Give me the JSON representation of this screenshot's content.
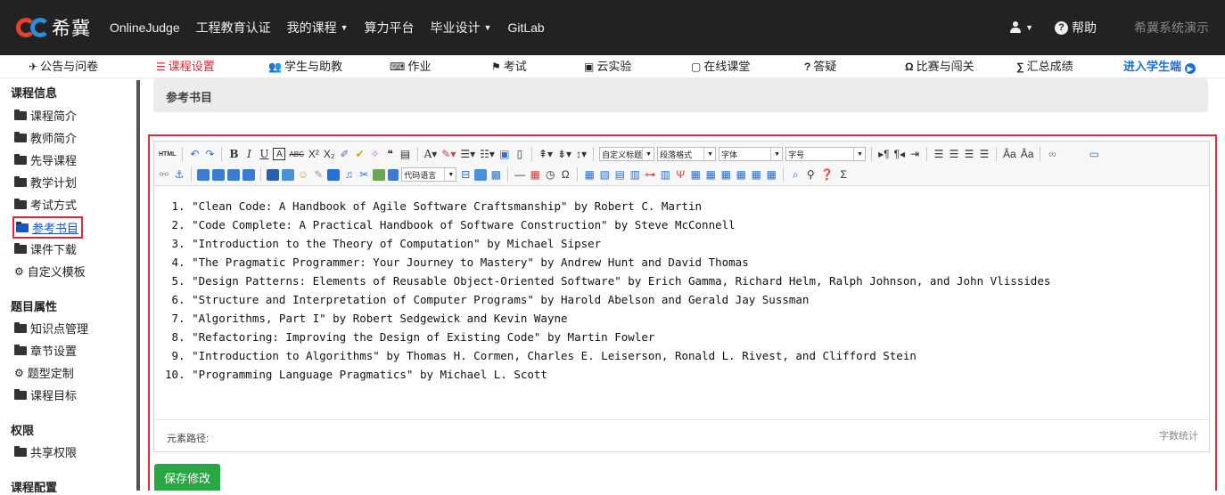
{
  "header": {
    "logo_text": "希冀",
    "nav": [
      {
        "label": "OnlineJudge",
        "dropdown": false
      },
      {
        "label": "工程教育认证",
        "dropdown": false
      },
      {
        "label": "我的课程",
        "dropdown": true
      },
      {
        "label": "算力平台",
        "dropdown": false
      },
      {
        "label": "毕业设计",
        "dropdown": true
      },
      {
        "label": "GitLab",
        "dropdown": false
      }
    ],
    "help_label": "帮助",
    "system_demo": "希冀系统演示"
  },
  "course_nav": [
    {
      "label": "公告与问卷",
      "icon": "✈"
    },
    {
      "label": "课程设置",
      "icon": "☰"
    },
    {
      "label": "学生与助教",
      "icon": "👥"
    },
    {
      "label": "作业",
      "icon": "⌨"
    },
    {
      "label": "考试",
      "icon": "⚑"
    },
    {
      "label": "云实验",
      "icon": "▣"
    },
    {
      "label": "在线课堂",
      "icon": "▢"
    },
    {
      "label": "答疑",
      "icon": "?"
    },
    {
      "label": "比赛与闯关",
      "icon": "Ω"
    },
    {
      "label": "汇总成绩",
      "icon": "∑"
    },
    {
      "label": "进入学生端",
      "icon": ""
    }
  ],
  "sidebar": {
    "course_info": {
      "title": "课程信息",
      "items": [
        "课程简介",
        "教师简介",
        "先导课程",
        "教学计划",
        "考试方式",
        "参考书目",
        "课件下载",
        "自定义模板"
      ]
    },
    "question_props": {
      "title": "题目属性",
      "items": [
        "知识点管理",
        "章节设置",
        "题型定制",
        "课程目标"
      ]
    },
    "permissions": {
      "title": "权限",
      "items": [
        "共享权限"
      ]
    },
    "course_config": {
      "title": "课程配置"
    }
  },
  "section_title": "参考书目",
  "toolbar": {
    "custom_heading": "自定义标题",
    "paragraph_format": "段落格式",
    "font": "字体",
    "font_size": "字号",
    "code_language": "代码语言"
  },
  "editor_lines": [
    " 1. \"Clean Code: A Handbook of Agile Software Craftsmanship\" by Robert C. Martin",
    " 2. \"Code Complete: A Practical Handbook of Software Construction\" by Steve McConnell",
    " 3. \"Introduction to the Theory of Computation\" by Michael Sipser",
    " 4. \"The Pragmatic Programmer: Your Journey to Mastery\" by Andrew Hunt and David Thomas",
    " 5. \"Design Patterns: Elements of Reusable Object-Oriented Software\" by Erich Gamma, Richard Helm, Ralph Johnson, and John Vlissides",
    " 6. \"Structure and Interpretation of Computer Programs\" by Harold Abelson and Gerald Jay Sussman",
    " 7. \"Algorithms, Part I\" by Robert Sedgewick and Kevin Wayne",
    " 8. \"Refactoring: Improving the Design of Existing Code\" by Martin Fowler",
    " 9. \"Introduction to Algorithms\" by Thomas H. Cormen, Charles E. Leiserson, Ronald L. Rivest, and Clifford Stein",
    "10. \"Programming Language Pragmatics\" by Michael L. Scott"
  ],
  "statusbar": {
    "element_path": "元素路径:",
    "word_count": "字数统计"
  },
  "save_button": "保存修改"
}
